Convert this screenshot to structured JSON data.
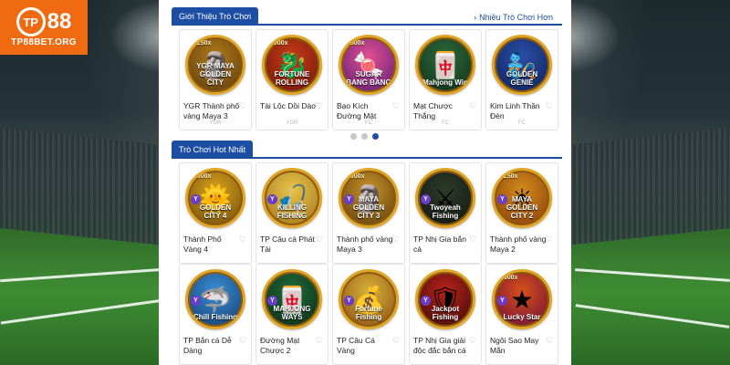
{
  "brand": {
    "mark": "TP",
    "number": "88",
    "site": "TP88BET.ORG",
    "color": "#f06a12"
  },
  "accent": "#1c4fa3",
  "intro": {
    "tab": "Giới Thiệu Trò Chơi",
    "more": "Nhiều Trò Chơi Hơn",
    "games": [
      {
        "title": "YGR Thành phố vàng Maya 3",
        "art": "YGR MAYA GOLDEN CITY",
        "badge": "7250x",
        "provider": "YGR",
        "icon": "maya-temple-icon"
      },
      {
        "title": "Tài Lộc Dồi Dào",
        "art": "FORTUNE ROLLING",
        "badge": "1000x",
        "provider": "YGR",
        "icon": "dragon-icon"
      },
      {
        "title": "Bạo Kích Đường Mật",
        "art": "SUGAR BANG BANG",
        "badge": "2500x",
        "provider": "FC",
        "icon": "candy-icon"
      },
      {
        "title": "Mạt Chược Thắng",
        "art": "Mahjong Win",
        "badge": "",
        "provider": "FC",
        "icon": "mahjong-tile-icon"
      },
      {
        "title": "Kim Linh Thần Đèn",
        "art": "GOLDEN GENIE",
        "badge": "",
        "provider": "FC",
        "icon": "genie-icon"
      }
    ],
    "dots": 3,
    "active_dot": 2
  },
  "hot": {
    "tab": "Trò Chơi Hot Nhất",
    "games": [
      {
        "title": "Thành Phố Vàng 4",
        "art": "GOLDEN CITY 4",
        "badge": "1000x",
        "icon": "golden-face-icon"
      },
      {
        "title": "TP Câu cá Phát Tài",
        "art": "KILLING FISHING",
        "badge": "",
        "icon": "fish-hook-icon"
      },
      {
        "title": "Thành phố vàng Maya 3",
        "art": "MAYA GOLDEN CITY 3",
        "badge": "1000x",
        "icon": "maya-temple-icon"
      },
      {
        "title": "TP Nhị Gia bắn cá",
        "art": "Twoyeah Fishing",
        "badge": "",
        "icon": "warrior-icon"
      },
      {
        "title": "Thành phố vàng Maya 2",
        "art": "MAYA GOLDEN CITY 2",
        "badge": "1250x",
        "icon": "sun-mask-icon"
      },
      {
        "title": "TP Bắn cá Dễ Dàng",
        "art": "Chill Fishing",
        "badge": "",
        "icon": "shark-icon"
      },
      {
        "title": "Đường Mạt Chược 2",
        "art": "MAHJONG WAYS",
        "badge": "",
        "icon": "mahjong-icon"
      },
      {
        "title": "TP Câu Cá Vàng",
        "art": "Fortune Fishing",
        "badge": "",
        "icon": "fortune-god-icon"
      },
      {
        "title": "TP Nhị Gia giải độc đắc bắn cá",
        "art": "Jackpot Fishing",
        "badge": "",
        "icon": "general-icon"
      },
      {
        "title": "Ngôi Sao May Mắn",
        "art": "Lucky Star",
        "badge": "5000x",
        "icon": "star-icon"
      }
    ]
  }
}
